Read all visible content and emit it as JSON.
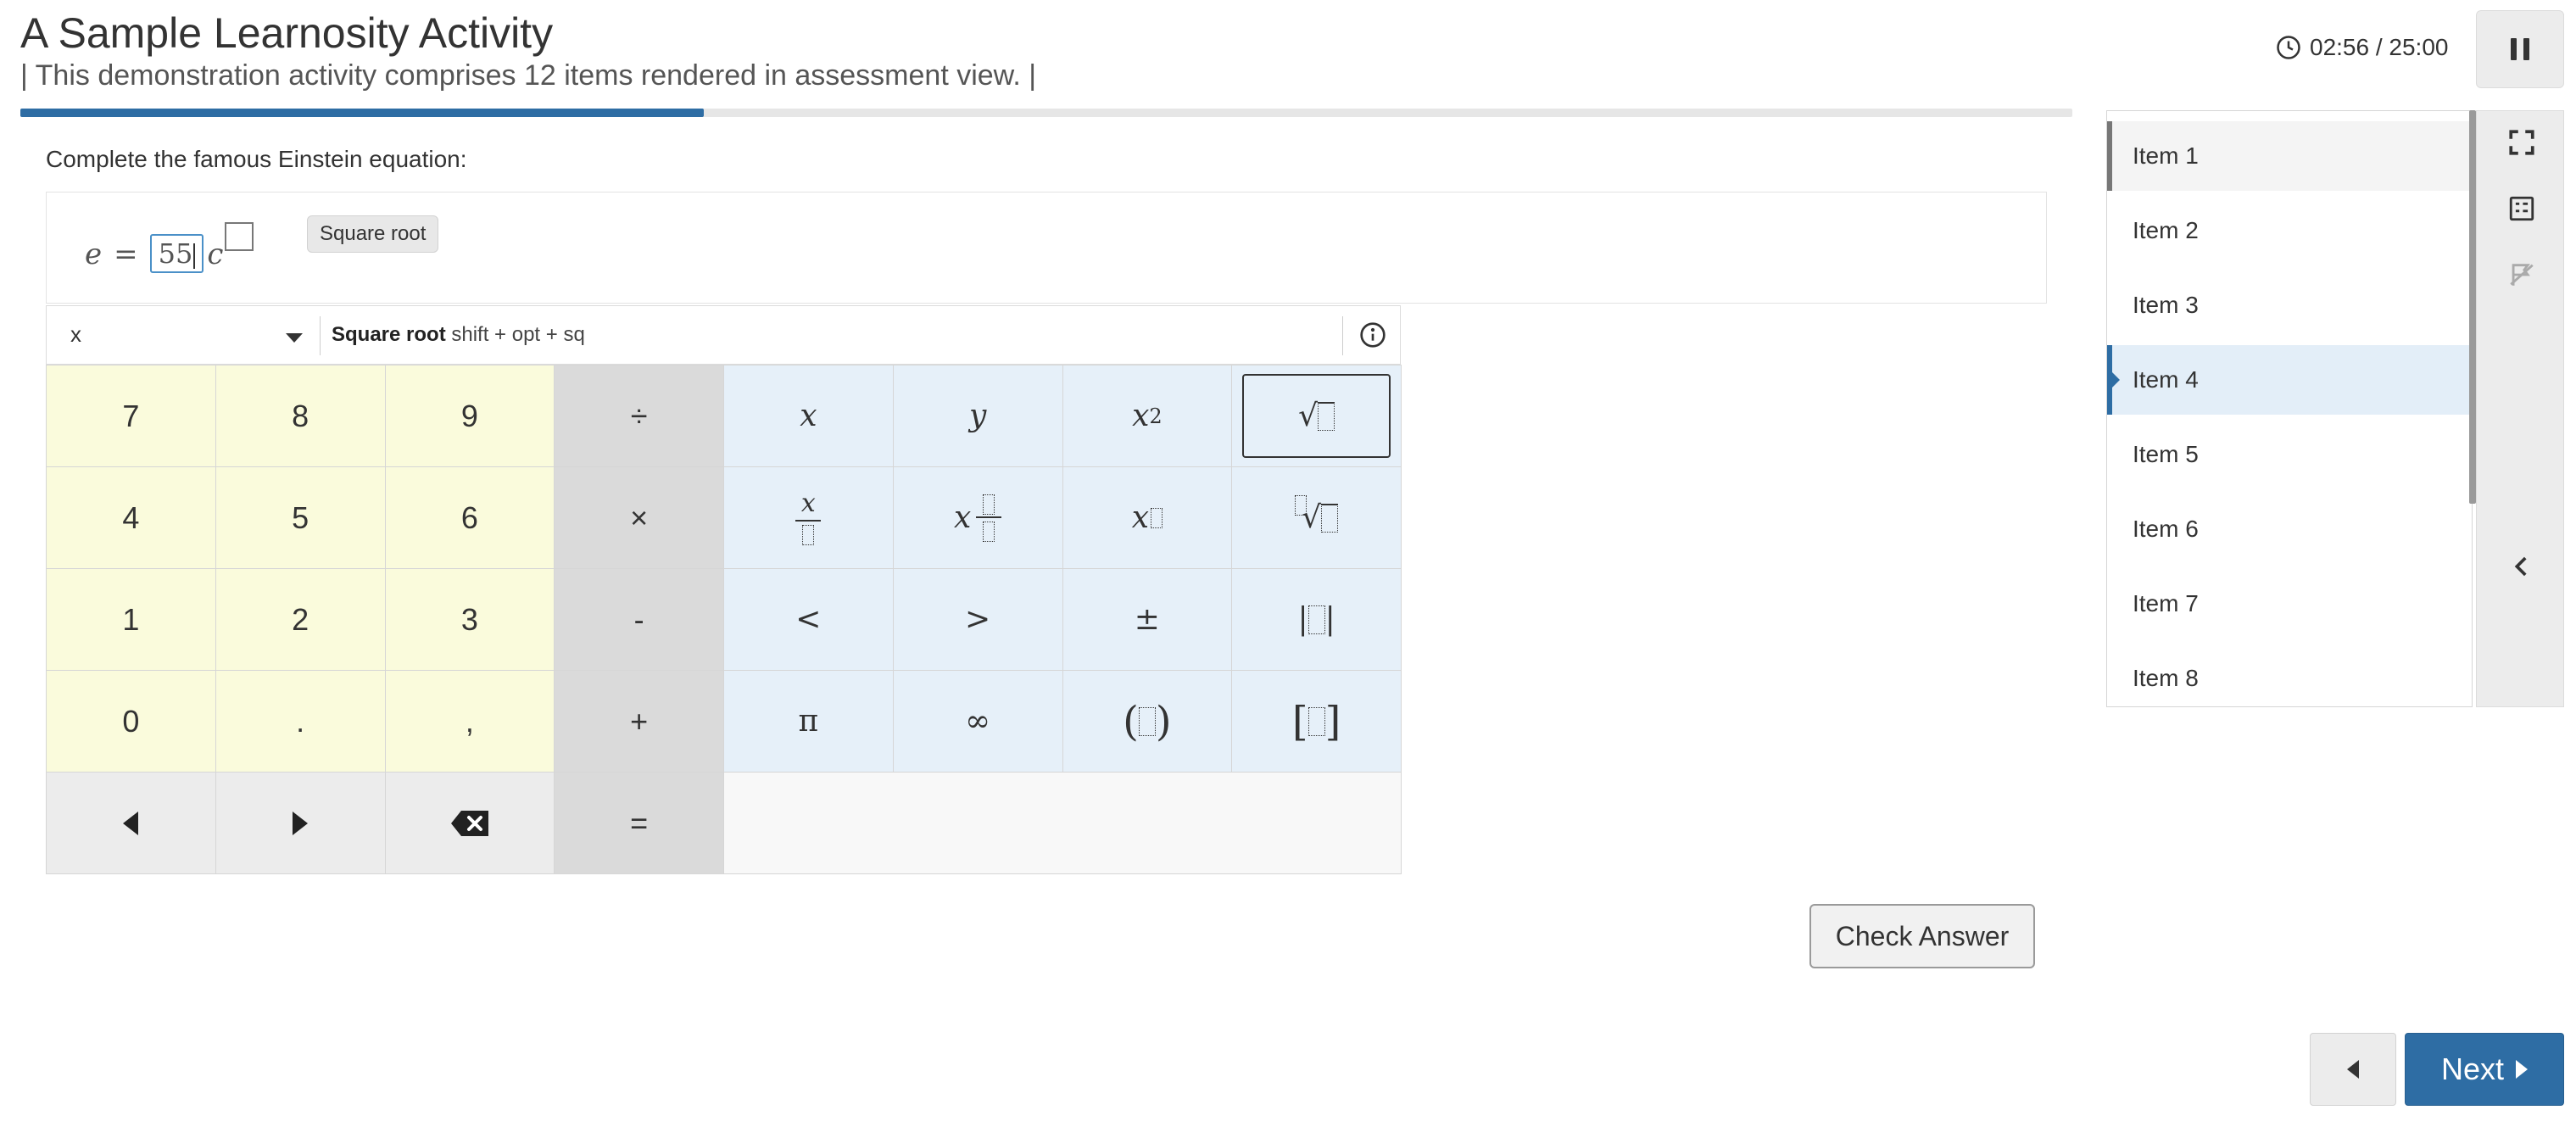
{
  "header": {
    "title": "A Sample Learnosity Activity",
    "subtitle": "| This demonstration activity comprises 12 items rendered in assessment view. |",
    "timer": "02:56 / 25:00",
    "progress_fraction": 0.333
  },
  "question": {
    "prompt": "Complete the famous Einstein equation:",
    "lhs": "e",
    "equals": "=",
    "input_value": "55",
    "variable": "c",
    "tooltip": "Square root"
  },
  "keypad": {
    "selected_group": "x",
    "hint_name": "Square root",
    "hint_shortcut": "shift + opt + sq",
    "keys": {
      "seven": "7",
      "eight": "8",
      "nine": "9",
      "divide": "÷",
      "x": "x",
      "y": "y",
      "x_squared_base": "x",
      "x_squared_exp": "2",
      "sqrt_sign": "√",
      "four": "4",
      "five": "5",
      "six": "6",
      "times": "×",
      "frac_num": "x",
      "mixed_whole": "x",
      "power_base": "x",
      "nthroot_sign": "√",
      "one": "1",
      "two": "2",
      "three": "3",
      "minus": "-",
      "less_than": "<",
      "greater_than": ">",
      "plus_minus": "±",
      "abs_open": "|",
      "abs_close": "|",
      "zero": "0",
      "decimal": ".",
      "comma": ",",
      "plus": "+",
      "pi": "π",
      "infinity": "∞",
      "paren_open": "(",
      "paren_close": ")",
      "bracket_open": "[",
      "bracket_close": "]",
      "equals": "="
    }
  },
  "actions": {
    "check_answer": "Check Answer",
    "next": "Next"
  },
  "item_list": {
    "items": [
      "Item 1",
      "Item 2",
      "Item 3",
      "Item 4",
      "Item 5",
      "Item 6",
      "Item 7",
      "Item 8"
    ],
    "current_index": 3
  },
  "colors": {
    "accent": "#2e6da4",
    "number_keys": "#fafbdc",
    "operator_keys": "#dadada",
    "symbol_keys": "#e6f0f9"
  }
}
